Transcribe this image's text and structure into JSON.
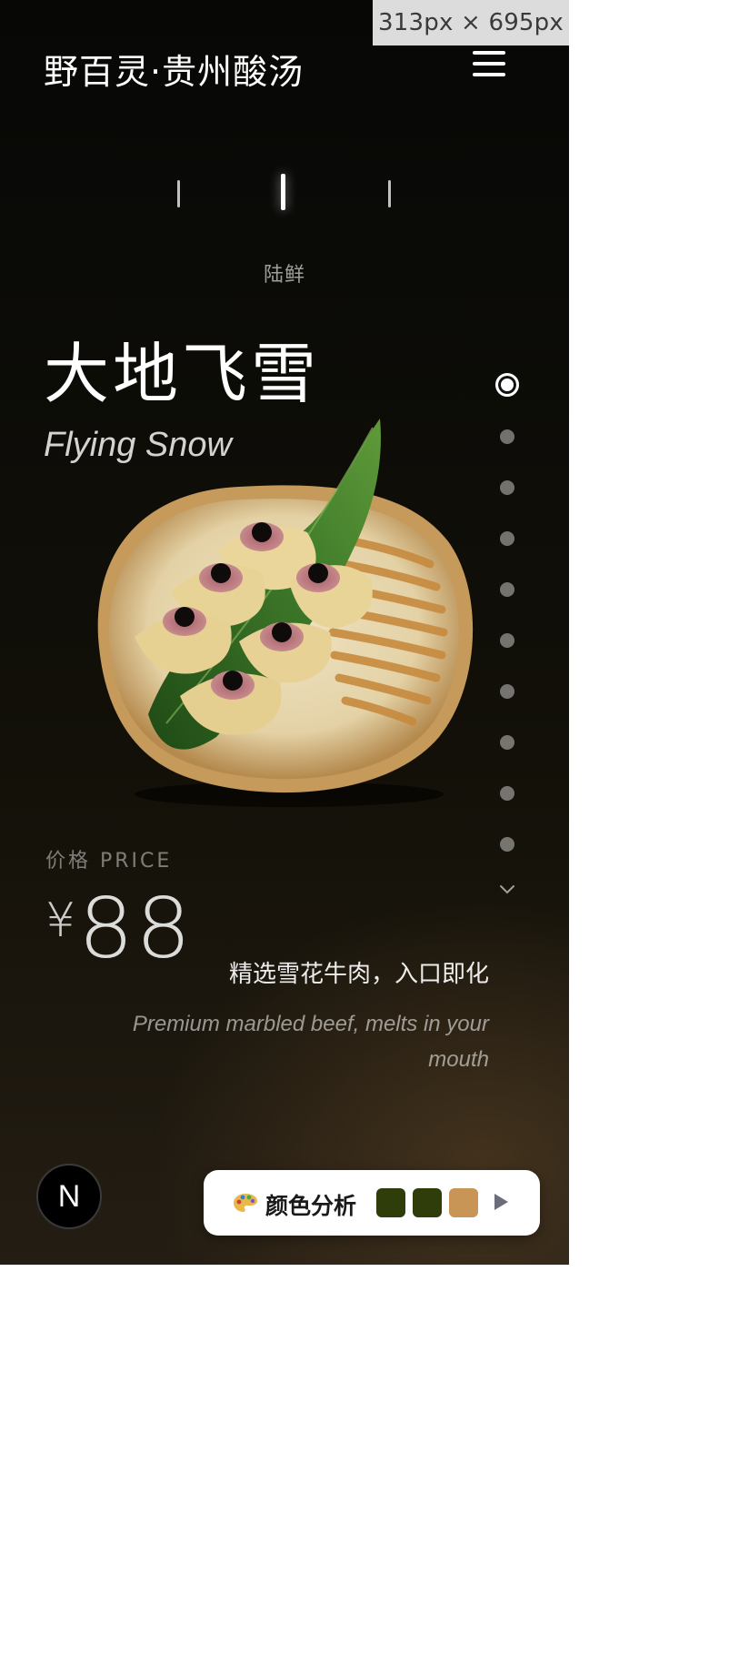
{
  "devtools": {
    "dimensions": "313px × 695px"
  },
  "header": {
    "brand": "野百灵·贵州酸汤",
    "menu_icon": "hamburger-menu-icon"
  },
  "category_tabs": {
    "count": 3,
    "active_index": 1,
    "active_label": "陆鲜"
  },
  "dish": {
    "name_cn": "大地飞雪",
    "name_en": "Flying Snow",
    "price_label": "价格 PRICE",
    "currency": "¥",
    "price": "88",
    "desc_cn": "精选雪花牛肉，入口即化",
    "desc_en": "Premium marbled beef, melts in your mouth"
  },
  "pagination": {
    "total": 10,
    "active_index": 0,
    "next_icon": "chevron-down-icon"
  },
  "badge": {
    "letter": "N"
  },
  "color_analysis": {
    "icon": "palette-icon",
    "label": "颜色分析",
    "swatches": [
      "#2f3d0a",
      "#2f3d0a",
      "#c99557"
    ],
    "play_icon": "play-icon"
  }
}
